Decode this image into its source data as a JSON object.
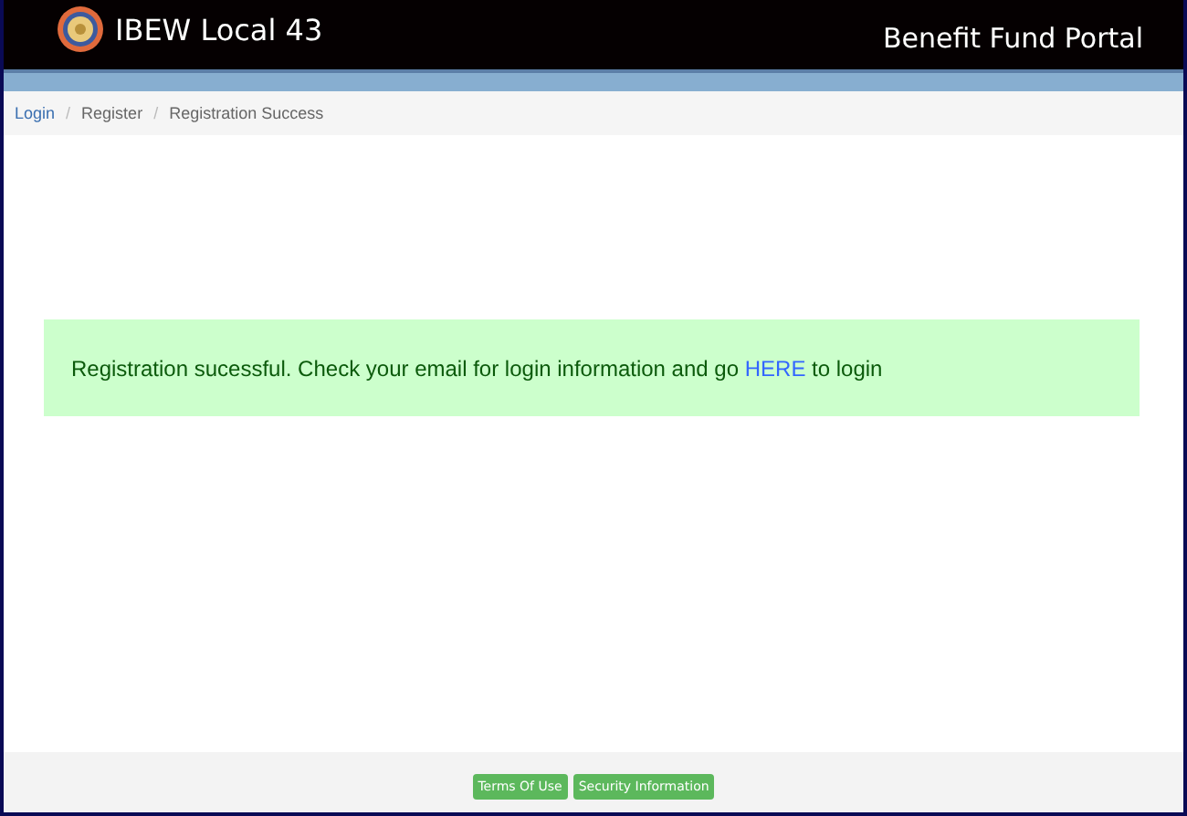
{
  "header": {
    "title": "IBEW Local 43",
    "portal": "Benefit Fund Portal"
  },
  "breadcrumb": {
    "separator": "/",
    "items": [
      {
        "label": "Login",
        "link": true
      },
      {
        "label": "Register",
        "link": false
      },
      {
        "label": "Registration Success",
        "link": false
      }
    ]
  },
  "message": {
    "before": "Registration sucessful. Check your email for login information and go ",
    "link": "HERE",
    "after": " to login"
  },
  "footer_buttons": [
    "Terms Of Use",
    "Security Information"
  ]
}
